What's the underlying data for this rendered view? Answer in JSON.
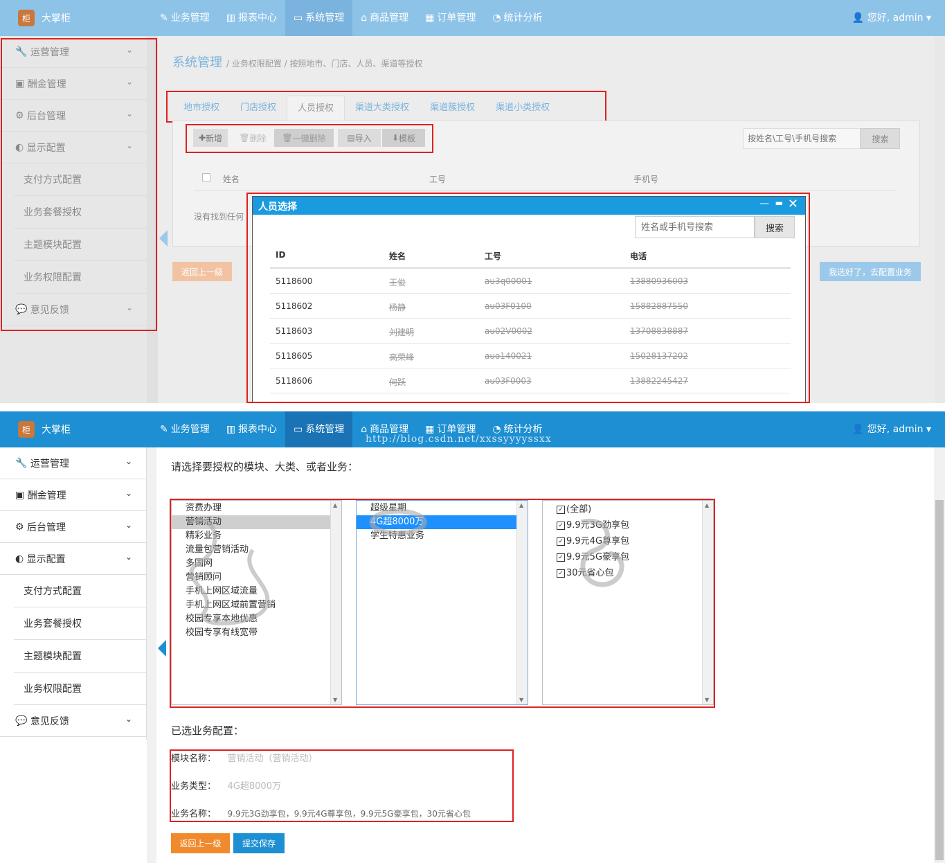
{
  "app": {
    "logo_text": "大掌柜",
    "nav": [
      "业务管理",
      "报表中心",
      "系统管理",
      "商品管理",
      "订单管理",
      "统计分析"
    ],
    "user_label": "您好, admin"
  },
  "sidebar": {
    "groups": [
      "运营管理",
      "酬金管理",
      "后台管理",
      "显示配置"
    ],
    "sub_items": [
      "支付方式配置",
      "业务套餐授权",
      "主题模块配置",
      "业务权限配置"
    ],
    "last_group": "意见反馈"
  },
  "top": {
    "breadcrumb_title": "系统管理",
    "breadcrumb_path": "/ 业务权限配置 / 按照地市、门店、人员、渠道等授权",
    "tabs": [
      "地市授权",
      "门店授权",
      "人员授权",
      "渠道大类授权",
      "渠道簇授权",
      "渠道小类授权"
    ],
    "active_tab_index": 2,
    "toolbar": {
      "add": "新增",
      "delete": "删除",
      "batch_delete": "一键删除",
      "import": "导入",
      "template": "模板"
    },
    "search_placeholder": "按姓名\\工号\\手机号搜索",
    "search_button": "搜索",
    "columns": [
      "姓名",
      "工号",
      "手机号"
    ],
    "empty_text": "没有找到任何",
    "back_button": "返回上一级",
    "next_button": "我选好了，去配置业务",
    "dialog": {
      "title": "人员选择",
      "search_placeholder": "姓名或手机号搜索",
      "search_button": "搜索",
      "columns": [
        "ID",
        "姓名",
        "工号",
        "电话"
      ],
      "rows": [
        {
          "id": "5118600",
          "name": "王俊",
          "job_no": "au3q00001",
          "phone": "13880936003"
        },
        {
          "id": "5118602",
          "name": "杨静",
          "job_no": "au03F0100",
          "phone": "15882887550"
        },
        {
          "id": "5118603",
          "name": "刘建明",
          "job_no": "au02V0002",
          "phone": "13708838887"
        },
        {
          "id": "5118605",
          "name": "高荣峰",
          "job_no": "auo140021",
          "phone": "15028137202"
        },
        {
          "id": "5118606",
          "name": "何跃",
          "job_no": "au03F0003",
          "phone": "13882245427"
        }
      ]
    }
  },
  "bottom": {
    "watermark": "http://blog.csdn.net/xxssyyyyssxx",
    "prompt": "请选择要授权的模块、大类、或者业务：",
    "list1": [
      "资费办理",
      "营销活动",
      "精彩业务",
      "流量包营销活动",
      "多国网",
      "营销顾问",
      "手机上网区域流量",
      "手机上网区域前置营销",
      "校园专享本地优惠",
      "校园专享有线宽带"
    ],
    "list1_selected_index": 1,
    "list2": [
      "超级星期",
      "4G超8000万",
      "学生特惠业务"
    ],
    "list2_selected_index": 1,
    "list3": [
      "(全部)",
      "9.9元3G劲享包",
      "9.9元4G尊享包",
      "9.9元5G豪享包",
      "30元省心包"
    ],
    "selected_title": "已选业务配置：",
    "module_label": "模块名称：",
    "module_value": "营销活动（营销活动）",
    "type_label": "业务类型：",
    "type_value": "4G超8000万",
    "name_label": "业务名称：",
    "name_value": "9.9元3G劲享包，9.9元4G尊享包，9.9元5G豪享包，30元省心包",
    "back_button": "返回上一级",
    "submit_button": "提交保存"
  },
  "colors": {
    "top_header": "#8ec3e8",
    "bottom_header": "#1d8fd2",
    "active_nav": "#1a73b5",
    "link_blue": "#5aaee0",
    "orange": "#f08a2c",
    "highlight": "#e02020"
  }
}
